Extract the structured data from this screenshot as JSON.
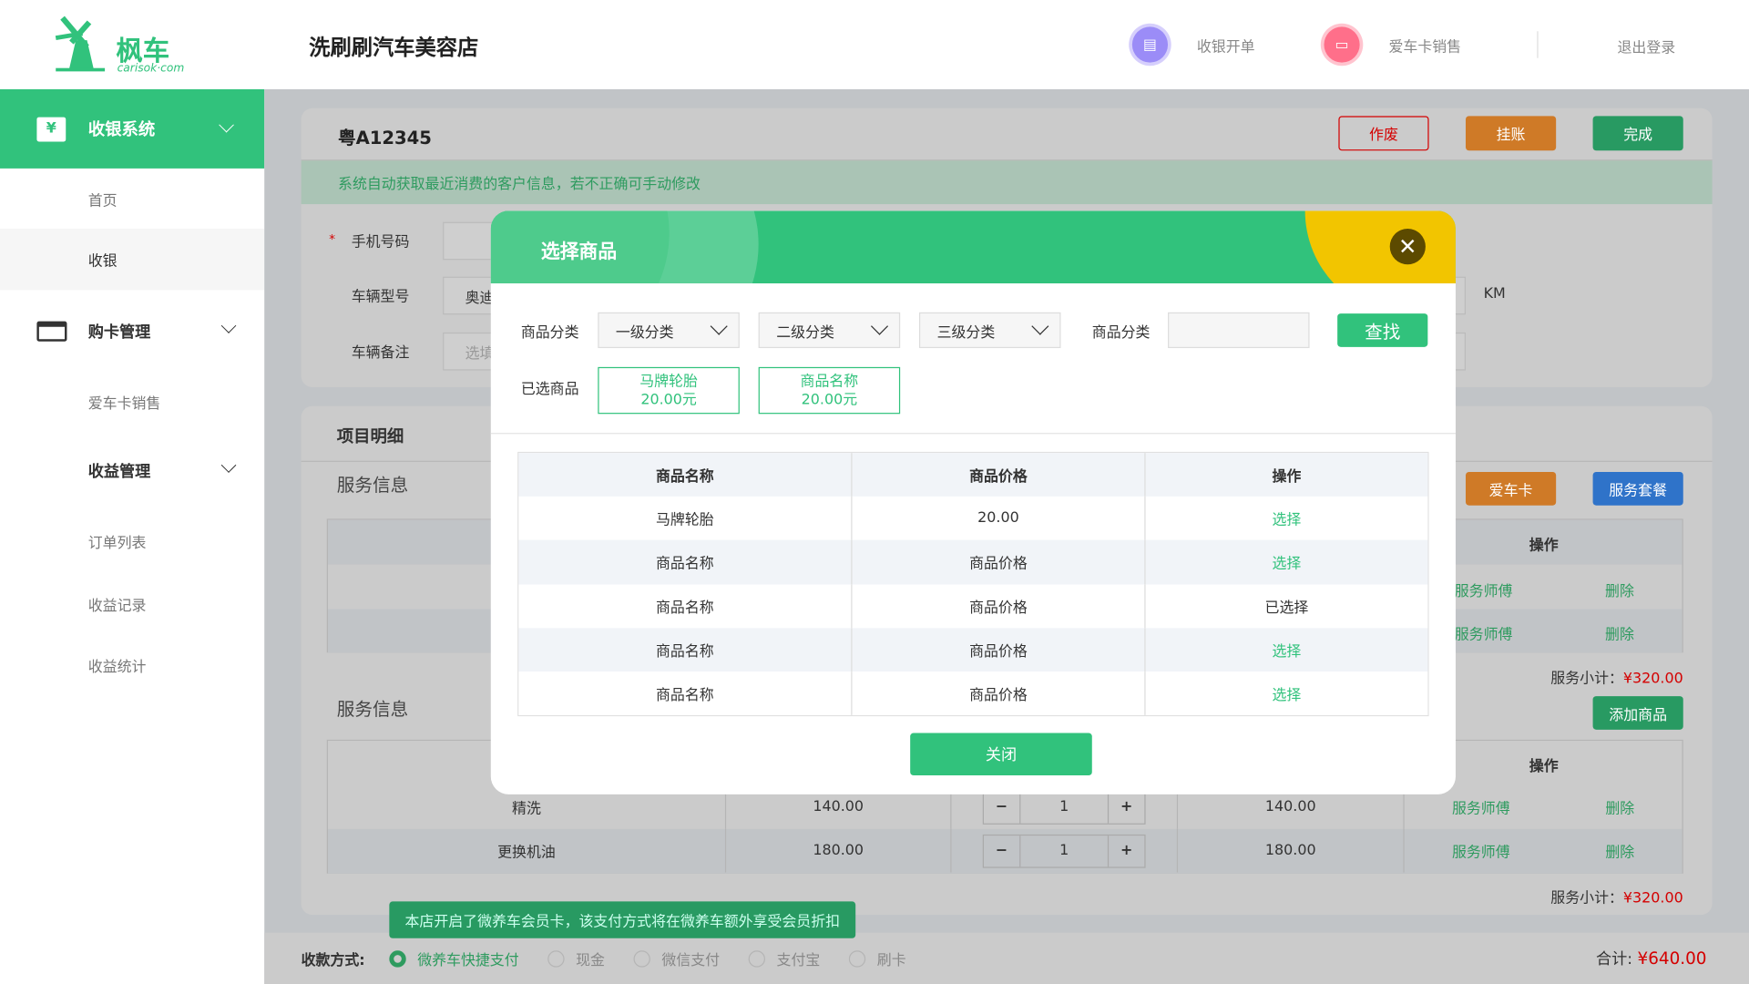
{
  "header": {
    "logo_text": "枫车",
    "logo_sub": "carisok·com",
    "store_name": "洗刷刷汽车美容店",
    "actions": [
      {
        "label": "收银开单",
        "icon": "bill-icon",
        "color": "#9b8cf7"
      },
      {
        "label": "爱车卡销售",
        "icon": "card-icon",
        "color": "#ff6f8a"
      }
    ],
    "logout": "退出登录"
  },
  "sidebar": {
    "groups": [
      {
        "label": "收银系统",
        "icon": "cashier-monitor-icon",
        "active": true,
        "items": [
          "首页",
          "收银"
        ]
      },
      {
        "label": "购卡管理",
        "icon": "card-icon",
        "items": [
          "爱车卡销售"
        ]
      },
      {
        "label": "收益管理",
        "items": [
          "订单列表",
          "收益记录",
          "收益统计"
        ]
      }
    ],
    "selected_item": "收银"
  },
  "order": {
    "plate": "粤A12345",
    "buttons": {
      "void": "作废",
      "credit": "挂账",
      "done": "完成"
    },
    "notice": "系统自动获取最近消费的客户信息，若不正确可手动修改",
    "fields": {
      "phone": "手机号码",
      "model": "车辆型号",
      "model_value": "奥迪",
      "remark": "车辆备注",
      "remark_placeholder": "选填",
      "km_unit": "KM"
    }
  },
  "details": {
    "title": "项目明细",
    "section1": "服务信息",
    "section2": "服务信息",
    "buttons": {
      "car_card": "爱车卡",
      "package": "服务套餐",
      "add_goods": "添加商品"
    },
    "op_header": "操作",
    "row_actions": {
      "tech": "服务师傅",
      "delete": "删除"
    },
    "rows": [
      {
        "name": "精洗",
        "price": "140.00",
        "qty": "1",
        "total": "140.00"
      },
      {
        "name": "更换机油",
        "price": "180.00",
        "qty": "1",
        "total": "180.00"
      }
    ],
    "subtotal_label": "服务小计：",
    "subtotal1": "¥320.00",
    "subtotal2": "¥320.00"
  },
  "payment": {
    "label": "收款方式:",
    "tooltip": "本店开启了微养车会员卡，该支付方式将在微养车额外享受会员折扣",
    "options": [
      "微养车快捷支付",
      "现金",
      "微信支付",
      "支付宝",
      "刷卡"
    ],
    "selected": "微养车快捷支付",
    "total_label": "合计:",
    "total": "¥640.00"
  },
  "modal": {
    "title": "选择商品",
    "filter_label": "商品分类",
    "selects": [
      "一级分类",
      "二级分类",
      "三级分类"
    ],
    "filter_label2": "商品分类",
    "search_value": "",
    "search_button": "查找",
    "selected_label": "已选商品",
    "chips": [
      {
        "name": "马牌轮胎",
        "price": "20.00元"
      },
      {
        "name": "商品名称",
        "price": "20.00元"
      }
    ],
    "columns": [
      "商品名称",
      "商品价格",
      "操作"
    ],
    "rows": [
      {
        "name": "马牌轮胎",
        "price": "20.00",
        "action": "选择"
      },
      {
        "name": "商品名称",
        "price": "商品价格",
        "action": "选择"
      },
      {
        "name": "商品名称",
        "price": "商品价格",
        "action": "已选择"
      },
      {
        "name": "商品名称",
        "price": "商品价格",
        "action": "选择"
      },
      {
        "name": "商品名称",
        "price": "商品价格",
        "action": "选择"
      }
    ],
    "close_button": "关闭"
  },
  "colors": {
    "brand": "#31c27c",
    "void": "#d40000",
    "credit": "#cf7a27",
    "done": "#289a62",
    "package": "#2f73c9",
    "accent_yellow": "#f2c500"
  }
}
